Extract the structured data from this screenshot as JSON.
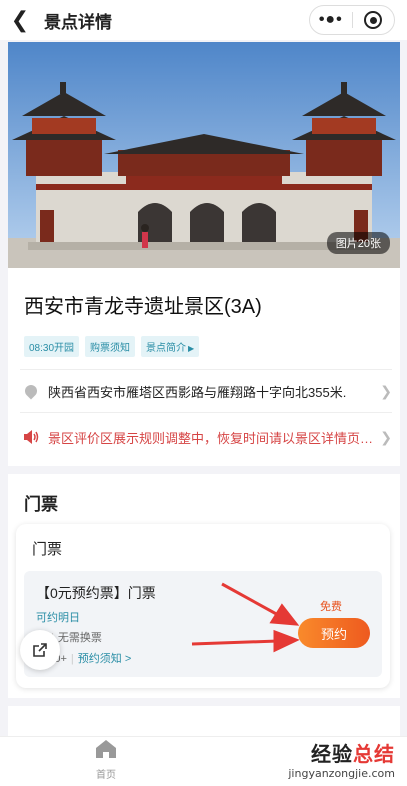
{
  "header": {
    "title": "景点详情"
  },
  "hero": {
    "photo_count": "图片20张"
  },
  "scenic": {
    "name": "西安市青龙寺遗址景区(3A)",
    "tags": [
      {
        "label": "08:30开园"
      },
      {
        "label": "购票须知"
      },
      {
        "label": "景点简介"
      }
    ],
    "address": "陕西省西安市雁塔区西影路与雁翔路十字向北355米.",
    "notice": "景区评价区展示规则调整中，恢复时间请以景区详情页公告为准"
  },
  "tickets": {
    "section_title": "门票",
    "card_title": "门票",
    "item": {
      "name": "【0元预约票】门票",
      "availability": "可约明日",
      "rule_refund": "退",
      "rule_exchange": "无需换票",
      "sales": "8000+",
      "booking_notes": "预约须知 >",
      "price": "免费",
      "book_label": "预约"
    }
  },
  "tabbar": {
    "home_label": "首页"
  },
  "watermark": {
    "cn": "经验总结",
    "en": "jingyanzongjie.com"
  }
}
